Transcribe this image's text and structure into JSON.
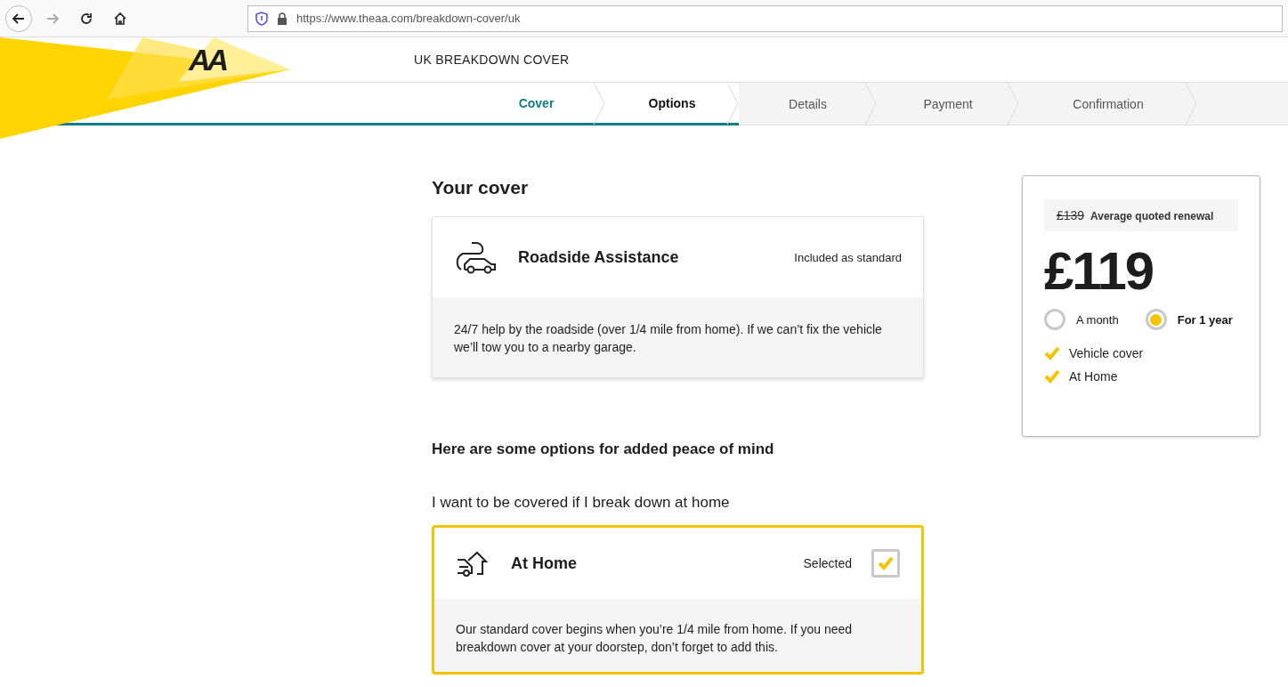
{
  "browser": {
    "back_disabled": false,
    "forward_disabled": true,
    "url": "https://www.theaa.com/breakdown-cover/uk"
  },
  "header": {
    "logo": "AA",
    "title": "UK BREAKDOWN COVER"
  },
  "steps": [
    {
      "label": "Cover",
      "completed": true,
      "selected": false
    },
    {
      "label": "Options",
      "completed": false,
      "selected": true
    },
    {
      "label": "Details",
      "completed": false,
      "selected": false
    },
    {
      "label": "Payment",
      "completed": false,
      "selected": false
    },
    {
      "label": "Confirmation",
      "completed": false,
      "selected": false
    }
  ],
  "cover": {
    "heading": "Your cover",
    "card": {
      "title": "Roadside Assistance",
      "note": "Included as standard",
      "description": "24/7 help by the roadside (over 1/4 mile from home). If we can’t fix the vehicle we’ll tow you to a nearby garage."
    }
  },
  "options": {
    "heading": "Here are some options for added peace of mind",
    "question": "I want to be covered if I break down at home",
    "card": {
      "title": "At Home",
      "status": "Selected",
      "checked": true,
      "description": "Our standard cover begins when you’re 1/4 mile from home. If you need breakdown cover at your doorstep, don’t forget to add this."
    }
  },
  "price": {
    "old_price": "£139",
    "old_label": "Average quoted renewal",
    "amount": "£119",
    "periods": [
      {
        "label": "A month",
        "selected": false
      },
      {
        "label": "For 1 year",
        "selected": true
      }
    ],
    "includes": [
      "Vehicle cover",
      "At Home"
    ]
  }
}
